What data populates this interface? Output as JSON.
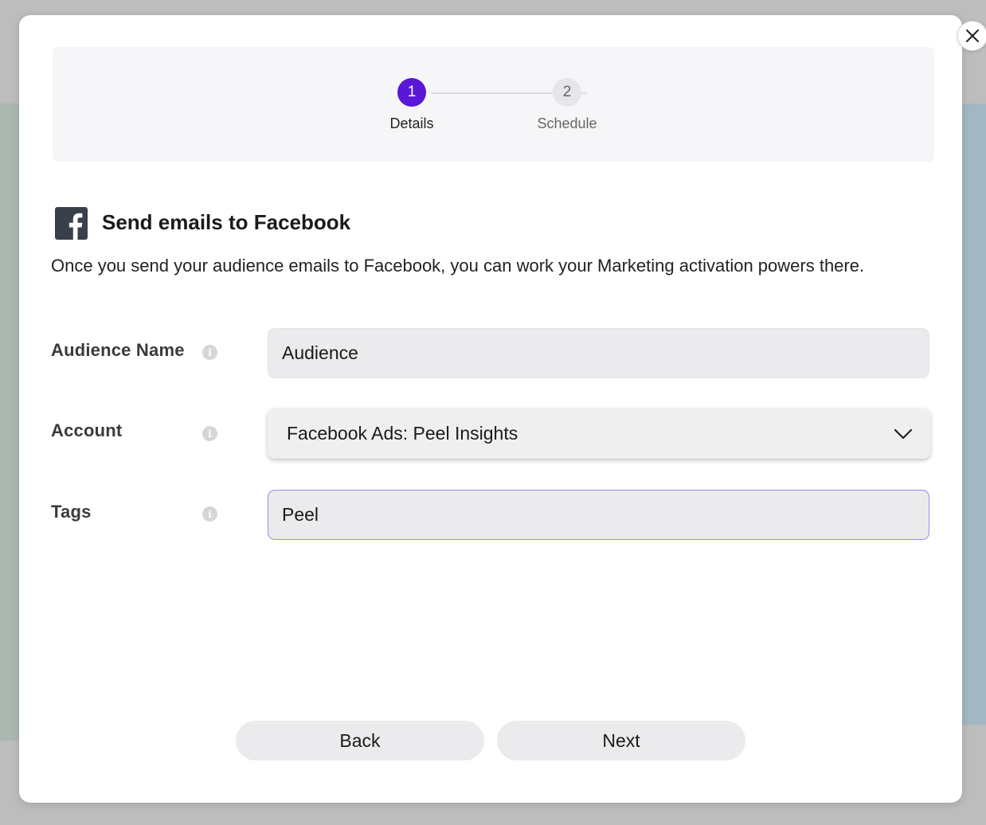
{
  "stepper": {
    "steps": [
      {
        "number": "1",
        "label": "Details",
        "active": true
      },
      {
        "number": "2",
        "label": "Schedule",
        "active": false
      }
    ],
    "active_color": "#5b16d6"
  },
  "header": {
    "icon": "facebook-icon",
    "title": "Send emails to Facebook",
    "description": "Once you send your audience emails to Facebook, you can work your Marketing activation powers there."
  },
  "form": {
    "audience_name": {
      "label": "Audience Name",
      "value": "Audience"
    },
    "account": {
      "label": "Account",
      "value": "Facebook Ads: Peel Insights"
    },
    "tags": {
      "label": "Tags",
      "value": "Peel"
    }
  },
  "actions": {
    "back_label": "Back",
    "next_label": "Next"
  }
}
